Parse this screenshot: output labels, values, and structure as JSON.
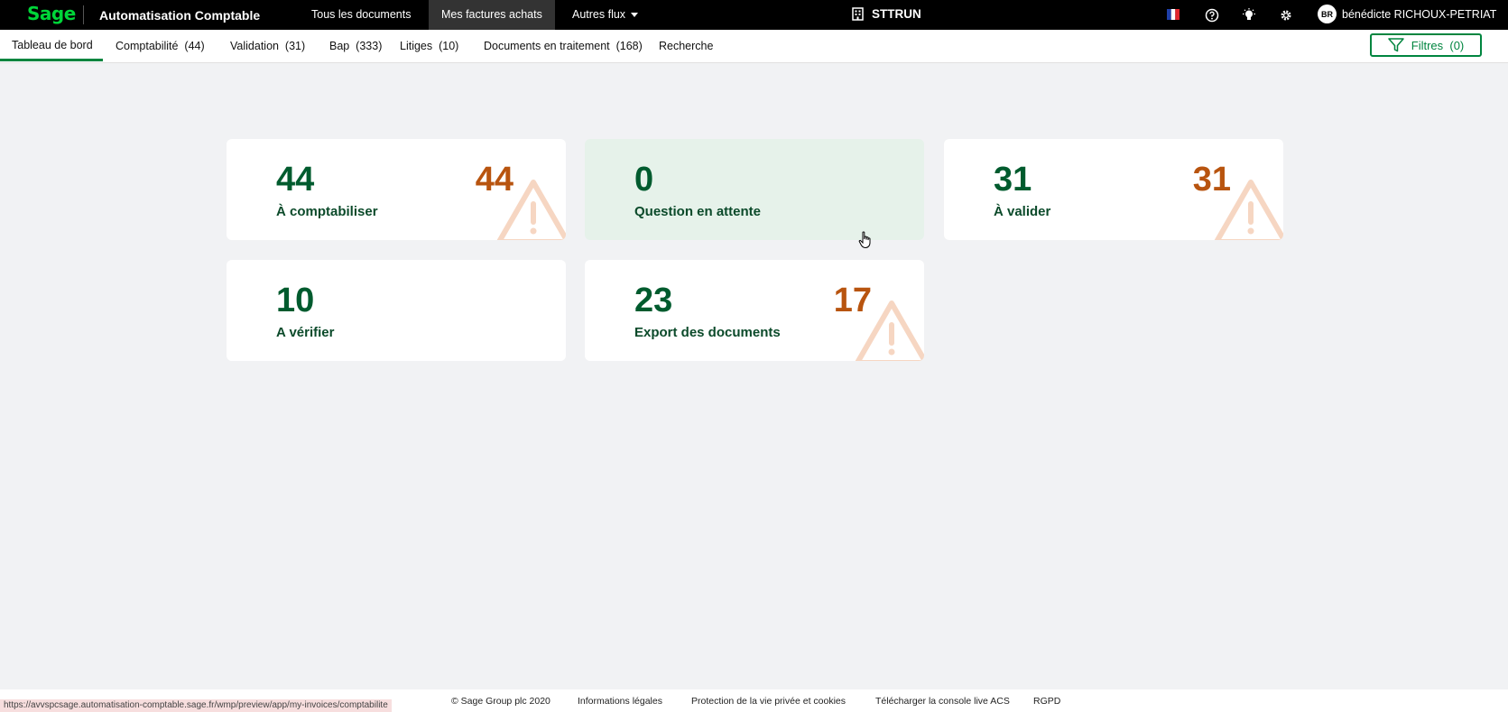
{
  "topbar": {
    "logo": "Sage",
    "app_title": "Automatisation Comptable",
    "nav": [
      "Tous les documents",
      "Mes factures achats",
      "Autres flux"
    ],
    "company": "STTRUN",
    "user_initials": "BR",
    "user_name": "bénédicte RICHOUX-PETRIAT"
  },
  "subnav": {
    "tabs": [
      "Tableau de bord",
      "Comptabilité  (44)",
      "Validation  (31)",
      "Bap  (333)",
      "Litiges  (10)",
      "Documents en traitement  (168)",
      "Recherche"
    ],
    "filter_label": "Filtres  (0)"
  },
  "cards": [
    {
      "count": "44",
      "label": "À comptabiliser",
      "alert": "44"
    },
    {
      "count": "0",
      "label": "Question en attente",
      "alert": ""
    },
    {
      "count": "31",
      "label": "À valider",
      "alert": "31"
    },
    {
      "count": "10",
      "label": "A vérifier",
      "alert": ""
    },
    {
      "count": "23",
      "label": "Export des documents",
      "alert": "17"
    }
  ],
  "footer": {
    "status_url": "https://avvspcsage.automatisation-comptable.sage.fr/wmp/preview/app/my-invoices/comptabilite",
    "links": [
      "© Sage Group plc 2020",
      "Informations légales",
      "Protection de la vie privée et cookies",
      "Télécharger la console live ACS",
      "RGPD"
    ]
  },
  "colors": {
    "brand_green": "#00d639",
    "primary_green": "#00853f",
    "count_green": "#005b2e",
    "alert_orange": "#b8540f",
    "highlight_bg": "#e6f2ea"
  },
  "icons": [
    "building-icon",
    "help-icon",
    "lightbulb-icon",
    "gear-icon",
    "france-flag-icon",
    "filter-icon",
    "warning-icon",
    "caret-down-icon"
  ]
}
